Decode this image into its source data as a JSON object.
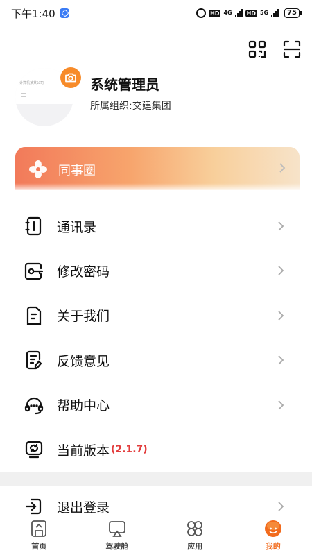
{
  "status_bar": {
    "time": "下午1:40",
    "network_4g": "4G",
    "network_5g": "5G",
    "hd_badge": "HD",
    "battery": "75"
  },
  "profile": {
    "name": "系统管理员",
    "org": "所属组织:交建集团",
    "avatar_cover_text": "计算机某某公司"
  },
  "banner": {
    "label": "同事圈"
  },
  "menu": {
    "items": [
      {
        "label": "通讯录",
        "icon": "contacts-icon"
      },
      {
        "label": "修改密码",
        "icon": "key-icon"
      },
      {
        "label": "关于我们",
        "icon": "document-icon"
      },
      {
        "label": "反馈意见",
        "icon": "feedback-icon"
      },
      {
        "label": "帮助中心",
        "icon": "headset-icon"
      },
      {
        "label": "当前版本",
        "icon": "version-icon",
        "version": "(2.1.7)"
      }
    ],
    "logout": {
      "label": "退出登录",
      "icon": "logout-icon"
    }
  },
  "bottom_nav": {
    "items": [
      {
        "label": "首页",
        "icon": "home-icon"
      },
      {
        "label": "驾驶舱",
        "icon": "cockpit-icon"
      },
      {
        "label": "应用",
        "icon": "apps-icon"
      },
      {
        "label": "我的",
        "icon": "profile-icon",
        "active": true
      }
    ]
  },
  "colors": {
    "accent": "#f26b1d",
    "camera_badge": "#f78b2a",
    "version_text": "#e23b3b"
  }
}
